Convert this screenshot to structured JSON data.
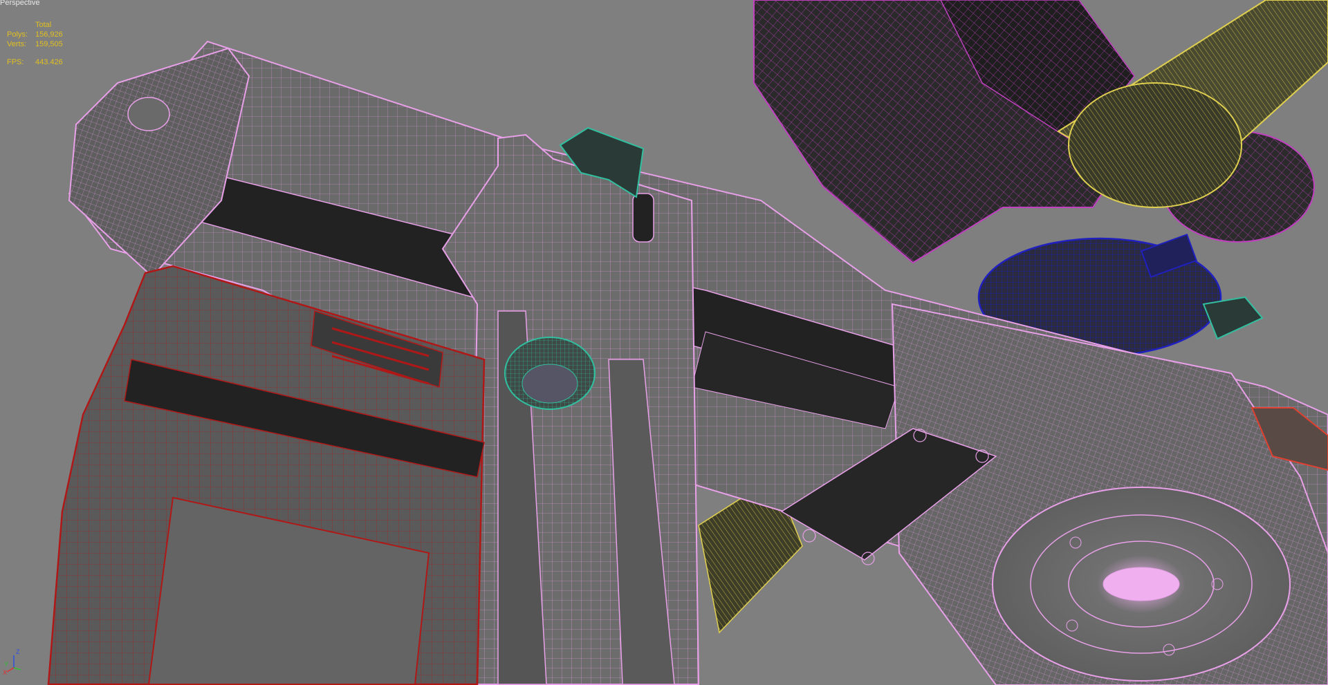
{
  "viewport": {
    "label": "Perspective",
    "background": "#7f7f7f"
  },
  "stats": {
    "header": "Total",
    "polys_label": "Polys:",
    "polys_value": "156,926",
    "verts_label": "Verts:",
    "verts_value": "159,505",
    "fps_label": "FPS:",
    "fps_value": "443.426",
    "color": "#e0c020"
  },
  "axis_gizmo": {
    "x_label": "X",
    "y_label": "Y",
    "z_label": "Z"
  },
  "wire_colors": {
    "pink": "#e8a0e8",
    "red": "#b01818",
    "teal": "#30c0a0",
    "blue": "#2020c0",
    "yellow": "#e0d050",
    "magenta": "#c040c0",
    "orange_red": "#e04030"
  },
  "icons": [
    "axis-gizmo-icon"
  ]
}
